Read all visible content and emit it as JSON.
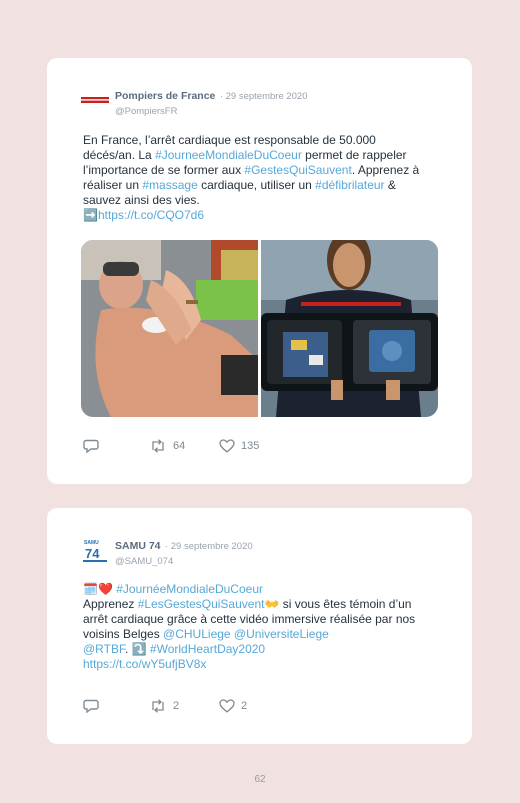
{
  "tweets": [
    {
      "author": "Pompiers de France",
      "date": "· 29 septembre 2020",
      "handle": "@PompiersFR",
      "text": {
        "t1": "En France, l’arrêt cardiaque est responsable de 50.000 décés/an. La ",
        "h1": "#JourneeMondialeDuCoeur",
        "t2": " permet de rappeler l’importance de se former aux ",
        "h2": "#GestesQuiSauvent",
        "t3": ". Apprenez à réaliser un ",
        "h3": "#massage",
        "t4": " cardiaque, utiliser un ",
        "h4": "#défibrilateur",
        "t5": " & sauvez ainsi des vies.",
        "arrow": "➡️",
        "link": "https://t.co/CQO7d6"
      },
      "retweets": "64",
      "likes": "135",
      "media_icons": [
        "cpr-manikin-photo",
        "defibrillator-photo"
      ]
    },
    {
      "author": "SAMU 74",
      "date": "· 29 septembre 2020",
      "handle": "@SAMU_074",
      "text": {
        "e1": "🗓️❤️",
        "h1": " #JournéeMondialeDuCoeur",
        "t1": "Apprenez ",
        "h2": "#LesGestesQuiSauvent",
        "e2": "👐",
        "t2": " si vous êtes témoin d’un arrêt cardiaque grâce à cette vidéo immersive réalisée par nos voisins Belges ",
        "m1": "@CHULiege",
        "m2": " @UniversiteLiege",
        "m3": "@RTBF",
        "t3": ". ",
        "e3": "⤵️",
        "h3": " #WorldHeartDay2020",
        "link": "https://t.co/wY5ufjBV8x"
      },
      "retweets": "2",
      "likes": "2"
    }
  ],
  "page_number": "62",
  "colors": {
    "background": "#f2e1e1",
    "card": "#ffffff",
    "hashtag": "#56a8d8",
    "meta": "#9aa3ad"
  },
  "icons": [
    "reply-icon",
    "retweet-icon",
    "like-icon"
  ]
}
